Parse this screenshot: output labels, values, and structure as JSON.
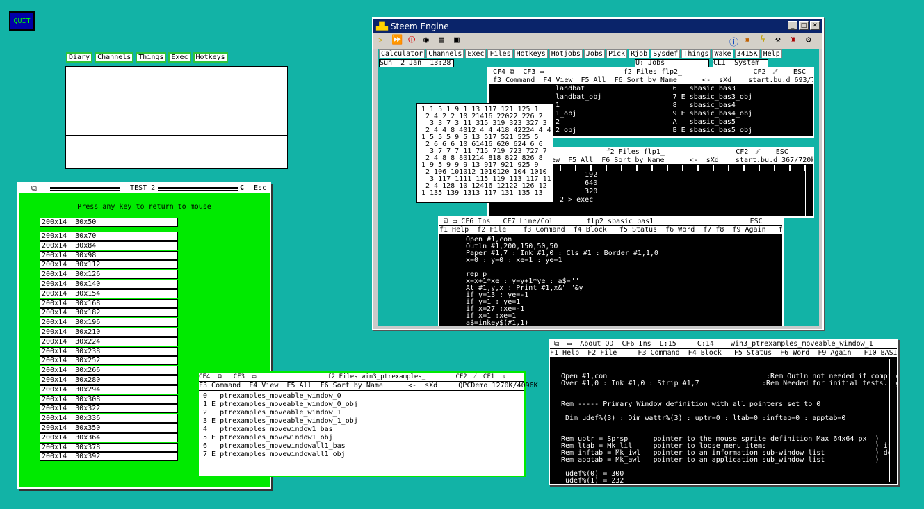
{
  "quit_label": "QUIT",
  "top_menu": [
    "Diary",
    "Channels",
    "Things",
    "Exec",
    "Hotkeys"
  ],
  "test2": {
    "title": "TEST 2",
    "close": "C",
    "esc": "Esc",
    "message": "Press any key to return to mouse",
    "rows": [
      "200x14  30x50",
      "200x14  30x70",
      "200x14  30x84",
      "200x14  30x98",
      "200x14  30x112",
      "200x14  30x126",
      "200x14  30x140",
      "200x14  30x154",
      "200x14  30x168",
      "200x14  30x182",
      "200x14  30x196",
      "200x14  30x210",
      "200x14  30x224",
      "200x14  30x238",
      "200x14  30x252",
      "200x14  30x266",
      "200x14  30x280",
      "200x14  30x294",
      "200x14  30x308",
      "200x14  30x322",
      "200x14  30x336",
      "200x14  30x350",
      "200x14  30x364",
      "200x14  30x378",
      "200x14  30x392"
    ]
  },
  "steem": {
    "title": "Steem Engine",
    "menu": [
      "Calculator",
      "Channels",
      "Exec",
      "Files",
      "Hotkeys",
      "Hotjobs",
      "Jobs",
      "Pick",
      "Rjob",
      "Sysdef",
      "Things",
      "Wake",
      "3415K",
      "Help"
    ],
    "date": "Sun  2 Jan  13:28",
    "status_right": "U: Jobs",
    "status_right2": "CLI  System",
    "flp2": {
      "hdr": " CF4 ⧉  CF3 ▭                   f2 Files flp2_                 CF2  ⁄⁄    ESC",
      "hdr2": " f3 Command  F4 View  F5 All  F6 Sort by Name      <-  sXd    start.bu.d 693/720k",
      "lines": [
        " landbat                     6   sbasic_bas3",
        " landbat_obj                 7 E sbasic_bas3_obj",
        " 1                           8   sbasic_bas4",
        " 1_obj                       9 E sbasic_bas4_obj",
        " 2                           A   sbasic_bas5",
        " 2_obj                       B E sbasic_bas5_obj"
      ]
    },
    "flp1": {
      "hdr": "                            f2 Files flp1_                 CF2  ⁄⁄    ESC",
      "hdr2": "ew  F5 All  F6 Sort by Name      <-  sXd    start.bu.d 367/720k",
      "lines": [
        "        192",
        "        640",
        "        320",
        "  2 > exec"
      ]
    },
    "numbers": [
      "1 1 5 1 9 1 13 117 121 125 1",
      " 2 4 2 2 10 21416 22022 226 2",
      "  3 3 7 3 11 315 319 323 327 3",
      " 2 4 4 8 4012 4 4 418 42224 4 4",
      "1 5 5 5 9 5 13 517 521 525 5",
      " 2 6 6 6 10 61416 620 624 6 6",
      "  3 7 7 7 11 715 719 723 727 7",
      " 2 4 8 8 801214 818 822 826 8",
      "1 9 5 9 9 9 13 917 921 925 9",
      " 2 106 101012 1010120 104 1010",
      "  3 117 1111 115 119 113 117 11",
      " 2 4 128 10 12416 12122 126 12",
      "1 135 139 1313 117 131 135 13"
    ],
    "editor": {
      "hdr": " ⧉ ▭ CF6 Ins   CF7 Line/Col        flp2_sbasic_bas1                       ESC",
      "hdr2": "f1 Help  f2 File    f3 Command  f4 Block   f5 Status  f6 Word  f7 f8  f9 Again   f10 BASIC",
      "code": [
        "Open #1,con_",
        "Outln #1,200,150,50,50",
        "Paper #1,7 : Ink #1,0 : Cls #1 : Border #1,1,0",
        "x=0 : y=0 : xe=1 : ye=1",
        "",
        "rep p",
        "x=x+1*xe : y=y+1*ye : a$=\"\"",
        "At #1,y,x : Print #1,x&\" \"&y",
        "if y=13 : ye=-1",
        "if y=1 : ye=1",
        "if x=27 :xe=-1",
        "if x=1 :xe=1",
        "a$=inkey$(#1,1)",
        "if a$<>\"\" : exit p"
      ]
    }
  },
  "ptfiles": {
    "hdr": "CF4  ⧉   CF3  ▭                   f2 Files win3_ptrexamples_        CF2  ⁄  CF1  ⇩",
    "hdr2": "F3 Command  F4 View  F5 All  F6 Sort by Name      <-  sXd     QPCDemo 1270K/4096K",
    "files": [
      "0   ptrexamples_moveable_window_0",
      "1 E ptrexamples_moveable_window_0_obj",
      "2   ptrexamples_moveable_window_1",
      "3 E ptrexamples_moveable_window_1_obj",
      "4   ptrexamples_movewindow1_bas",
      "5 E ptrexamples_movewindow1_obj",
      "6   ptrexamples_movewindowall1_bas",
      "7 E ptrexamples_movewindowall1_obj"
    ]
  },
  "qd": {
    "hdr": " ⧉  ▭  About QD  CF6 Ins  L:15     C:14    win3_ptrexamples_moveable_window_1          ESC",
    "hdr2": "F1 Help  F2 File     F3 Command  F4 Block   F5 Status  F6 Word  F9 Again   F10 BASIC      ⇳ ⇧",
    "code": [
      "Open #1,con_                                     :Rem Outln not needed if compiled with no",
      "Over #1,0 : Ink #1,0 : Strip #1,7               :Rem Needed for initial tests. eg. printi",
      "",
      "",
      "Rem ----- Primary Window definition with all pointers set to 0",
      "",
      " Dim udef%(3) : Dim wattr%(3) : uptr=0 : ltab=0 :inftab=0 : apptab=0",
      "",
      "",
      "Rem uptr = Sprsp      pointer to the mouse sprite definition Max 64x64 px  )",
      "Rem ltab = Mk_lil     pointer to loose menu items                          ) if",
      "Rem inftab = Mk_iwl   pointer to an information sub-window list            ) do",
      "Rem apptab = Mk_awl   pointer to an application sub_window list            )",
      "",
      " udef%(0) = 300",
      " udef%(1) = 232"
    ]
  }
}
